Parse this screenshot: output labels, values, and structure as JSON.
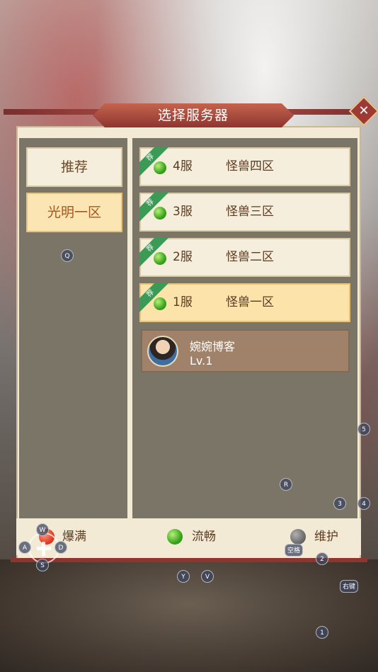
{
  "dialog": {
    "title": "选择服务器",
    "close_icon": "close-icon"
  },
  "tabs": [
    {
      "label": "推荐",
      "active": false
    },
    {
      "label": "光明一区",
      "active": true
    }
  ],
  "servers": [
    {
      "badge": "荐",
      "num": "4服",
      "name": "怪兽四区",
      "status": "smooth",
      "selected": false
    },
    {
      "badge": "荐",
      "num": "3服",
      "name": "怪兽三区",
      "status": "smooth",
      "selected": false
    },
    {
      "badge": "荐",
      "num": "2服",
      "name": "怪兽二区",
      "status": "smooth",
      "selected": false
    },
    {
      "badge": "荐",
      "num": "1服",
      "name": "怪兽一区",
      "status": "smooth",
      "selected": true
    }
  ],
  "player": {
    "name": "婉婉博客",
    "level": "Lv.1"
  },
  "legend": {
    "full": {
      "label": "爆满",
      "color": "#e0412b"
    },
    "smooth": {
      "label": "流畅",
      "color": "#3aa41c"
    },
    "maintain": {
      "label": "维护",
      "color": "#6e6e6e"
    }
  },
  "overlay_keys": {
    "q": "Q",
    "w": "W",
    "a": "A",
    "s": "S",
    "d": "D",
    "r": "R",
    "y": "Y",
    "v": "V",
    "k1": "1",
    "k2": "2",
    "k3": "3",
    "k4": "4",
    "k5": "5",
    "space": "空格",
    "right_click": "右键"
  }
}
